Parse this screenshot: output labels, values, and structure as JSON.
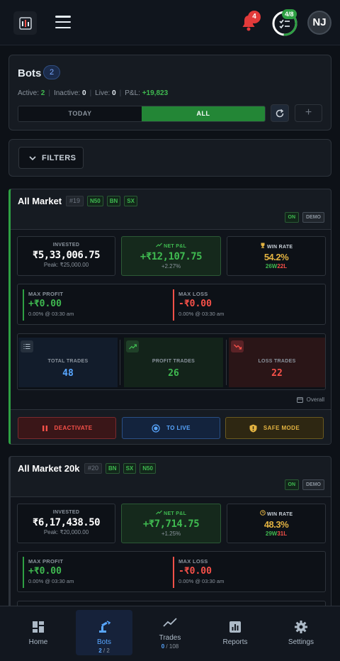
{
  "header": {
    "notification_count": "4",
    "tasks_badge": "4/8",
    "tasks_progress": 0.5,
    "avatar_initials": "NJ"
  },
  "bots_section": {
    "title": "Bots",
    "count": "2",
    "active_label": "Active:",
    "active_value": "2",
    "inactive_label": "Inactive:",
    "inactive_value": "0",
    "live_label": "Live:",
    "live_value": "0",
    "pnl_label": "P&L:",
    "pnl_value": "+19,823",
    "tab_today": "TODAY",
    "tab_all": "ALL",
    "add_label": "+"
  },
  "filters": {
    "label": "FILTERS"
  },
  "bots": [
    {
      "name": "All Market",
      "id": "#19",
      "indices": [
        "N50",
        "BN",
        "SX"
      ],
      "status": "ON",
      "mode": "DEMO",
      "invested_label": "INVESTED",
      "invested": "₹5,33,006.75",
      "peak": "Peak: ₹25,000.00",
      "pnl_label": "NET P&L",
      "pnl": "+₹12,107.75",
      "pnl_pct": "+2.27%",
      "winrate_label": "WIN RATE",
      "winrate": "54.2%",
      "wins": "26W",
      "losses": "22L",
      "max_profit_label": "MAX PROFIT",
      "max_profit": "+₹0.00",
      "max_profit_sub": "0.00% @ 03:30 am",
      "max_loss_label": "MAX LOSS",
      "max_loss": "-₹0.00",
      "max_loss_sub": "0.00% @ 03:30 am",
      "total_trades_label": "TOTAL TRADES",
      "total_trades": "48",
      "profit_trades_label": "PROFIT TRADES",
      "profit_trades": "26",
      "loss_trades_label": "LOSS TRADES",
      "loss_trades": "22",
      "period": "Overall",
      "deactivate_label": "DEACTIVATE",
      "to_live_label": "TO LIVE",
      "safe_mode_label": "SAFE MODE"
    },
    {
      "name": "All Market 20k",
      "id": "#20",
      "indices": [
        "BN",
        "SX",
        "N50"
      ],
      "status": "ON",
      "mode": "DEMO",
      "invested_label": "INVESTED",
      "invested": "₹6,17,438.50",
      "peak": "Peak: ₹20,000.00",
      "pnl_label": "NET P&L",
      "pnl": "+₹7,714.75",
      "pnl_pct": "+1.25%",
      "winrate_label": "WIN RATE",
      "winrate": "48.3%",
      "wins": "29W",
      "losses": "31L",
      "max_profit_label": "MAX PROFIT",
      "max_profit": "+₹0.00",
      "max_profit_sub": "0.00% @ 03:30 am",
      "max_loss_label": "MAX LOSS",
      "max_loss": "-₹0.00",
      "max_loss_sub": "0.00% @ 03:30 am"
    }
  ],
  "bottom_nav": {
    "home": "Home",
    "bots": "Bots",
    "bots_active": "2",
    "bots_total": "2",
    "trades": "Trades",
    "trades_active": "0",
    "trades_total": "108",
    "reports": "Reports",
    "settings": "Settings"
  },
  "colors": {
    "accent_green": "#2ea043",
    "accent_red": "#f85149",
    "accent_blue": "#58a6ff",
    "accent_gold": "#e3b341",
    "background": "#0d1117"
  }
}
